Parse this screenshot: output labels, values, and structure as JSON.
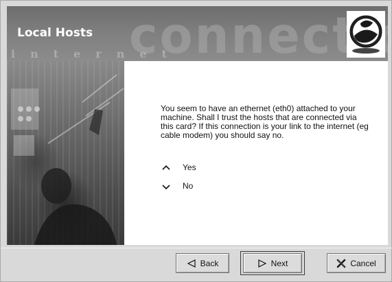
{
  "window": {
    "title": "Local Hosts",
    "banner_watermark": "connection",
    "banner_spaced": "internet"
  },
  "content": {
    "message": "You seem to have an ethernet (eth0) attached to your machine. Shall I trust the hosts that are connected via this card? If this connection is your link to the internet (eg cable modem) you should say no.",
    "options": [
      {
        "label": "Yes",
        "icon": "caret-up-icon"
      },
      {
        "label": "No",
        "icon": "caret-down-icon"
      }
    ]
  },
  "buttons": {
    "back_label": "Back",
    "next_label": "Next",
    "cancel_label": "Cancel"
  },
  "colors": {
    "banner": "#7a7a7a",
    "content_bg": "#ffffff",
    "window_bg": "#d9d9d9"
  }
}
